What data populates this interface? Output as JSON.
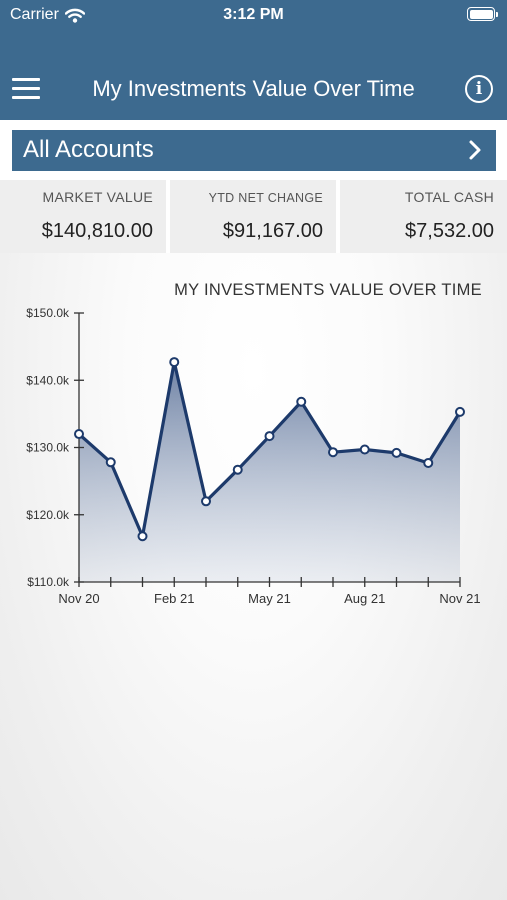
{
  "status_bar": {
    "carrier": "Carrier",
    "time": "3:12 PM"
  },
  "header": {
    "title": "My Investments Value Over Time",
    "menu_icon": "hamburger-menu-icon",
    "info_icon": "info-icon"
  },
  "accounts": {
    "label": "All Accounts",
    "chevron_icon": "chevron-right-icon"
  },
  "summary": {
    "market_value_label": "MARKET VALUE",
    "market_value": "$140,810.00",
    "ytd_label": "YTD NET CHANGE",
    "ytd_value": "$91,167.00",
    "cash_label": "TOTAL CASH",
    "cash_value": "$7,532.00"
  },
  "colors": {
    "header_bg": "#3d6a8f",
    "line": "#1d3a6b",
    "card_bg": "#eeeeee"
  },
  "chart_data": {
    "type": "area",
    "title": "MY INVESTMENTS VALUE OVER TIME",
    "ylim": [
      110000,
      150000
    ],
    "y_ticks": [
      {
        "value": 110000,
        "label": "$110.0k"
      },
      {
        "value": 120000,
        "label": "$120.0k"
      },
      {
        "value": 130000,
        "label": "$130.0k"
      },
      {
        "value": 140000,
        "label": "$140.0k"
      },
      {
        "value": 150000,
        "label": "$150.0k"
      }
    ],
    "x_tick_labels": [
      {
        "index": 0,
        "label": "Nov 20"
      },
      {
        "index": 3,
        "label": "Feb 21"
      },
      {
        "index": 6,
        "label": "May 21"
      },
      {
        "index": 9,
        "label": "Aug 21"
      },
      {
        "index": 12,
        "label": "Nov 21"
      }
    ],
    "x": [
      "Nov 20",
      "Dec 20",
      "Jan 21",
      "Feb 21",
      "Mar 21",
      "Apr 21",
      "May 21",
      "Jun 21",
      "Jul 21",
      "Aug 21",
      "Sep 21",
      "Oct 21",
      "Nov 21"
    ],
    "values": [
      132000,
      127800,
      116800,
      142700,
      122000,
      126700,
      131700,
      136800,
      129300,
      129700,
      129200,
      127700,
      135300
    ]
  }
}
